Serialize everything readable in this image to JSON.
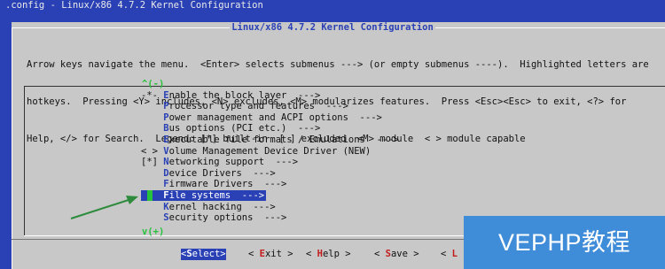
{
  "window": {
    "title": ".config - Linux/x86 4.7.2 Kernel Configuration"
  },
  "dialog": {
    "title": "Linux/x86 4.7.2 Kernel Configuration",
    "help_lines": [
      "Arrow keys navigate the menu.  <Enter> selects submenus ---> (or empty submenus ----).  Highlighted letters are",
      "hotkeys.  Pressing <Y> includes, <N> excludes, <M> modularizes features.  Press <Esc><Esc> to exit, <?> for",
      "Help, </> for Search.  Legend: [*] built-in  [ ] excluded  <M> module  < > module capable"
    ]
  },
  "menu": {
    "scroll_up": "^(-)",
    "scroll_down": "v(+)",
    "selected_index": 9,
    "items": [
      {
        "prefix": "-*- ",
        "hot": "E",
        "rest": "nable the block layer  --->"
      },
      {
        "prefix": "    ",
        "hot": "P",
        "rest": "rocessor type and features  --->"
      },
      {
        "prefix": "    ",
        "hot": "P",
        "rest": "ower management and ACPI options  --->"
      },
      {
        "prefix": "    ",
        "hot": "B",
        "rest": "us options (PCI etc.)  --->"
      },
      {
        "prefix": "    ",
        "hot": "E",
        "rest": "xecutable file formats / Emulations  --->"
      },
      {
        "prefix": "< > ",
        "hot": "V",
        "rest": "olume Management Device Driver (NEW)"
      },
      {
        "prefix": "[*] ",
        "hot": "N",
        "rest": "etworking support  --->"
      },
      {
        "prefix": "    ",
        "hot": "D",
        "rest": "evice Drivers  --->"
      },
      {
        "prefix": "    ",
        "hot": "F",
        "rest": "irmware Drivers  --->"
      },
      {
        "prefix": "    ",
        "hot": "F",
        "rest": "ile systems  --->"
      },
      {
        "prefix": "    ",
        "hot": "K",
        "rest": "ernel hacking  --->"
      },
      {
        "prefix": "    ",
        "hot": "S",
        "rest": "ecurity options  --->"
      }
    ]
  },
  "buttons": [
    {
      "open": "<",
      "hot": "S",
      "rest": "elect",
      "close": ">",
      "active": true
    },
    {
      "open": "< ",
      "hot": "E",
      "rest": "xit",
      "close": " >",
      "active": false
    },
    {
      "open": "< ",
      "hot": "H",
      "rest": "elp",
      "close": " >",
      "active": false
    },
    {
      "open": "< ",
      "hot": "S",
      "rest": "ave",
      "close": " >",
      "active": false
    },
    {
      "open": "< ",
      "hot": "L",
      "rest": "",
      "close": "",
      "active": false
    }
  ],
  "watermark": {
    "text": "VEPHP教程"
  },
  "colors": {
    "background": "#2a41b6",
    "dialog": "#c8c8c8",
    "hotkey": "#2a41b6",
    "button_hotkey": "#c21c1c",
    "arrow": "#2e8b3d",
    "scroll_indicator": "#27c23b"
  }
}
